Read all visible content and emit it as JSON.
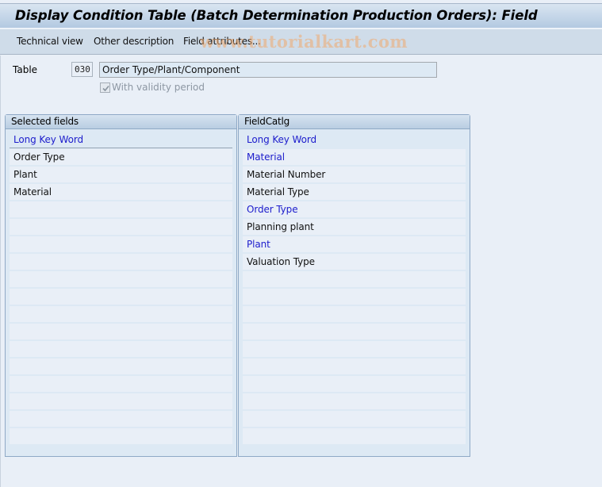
{
  "window": {
    "title": "Display Condition Table (Batch Determination Production Orders): Field"
  },
  "toolbar": {
    "buttons": [
      {
        "label": "Technical view"
      },
      {
        "label": "Other description"
      },
      {
        "label": "Field attributes..."
      }
    ]
  },
  "watermark": "www.tutorialkart.com",
  "form": {
    "table_label": "Table",
    "table_code": "030",
    "table_description": "Order Type/Plant/Component",
    "validity_checkbox": {
      "label": "With validity period",
      "checked": true,
      "enabled": false
    }
  },
  "selected_fields": {
    "title": "Selected fields",
    "column_header": "Long Key Word",
    "rows": [
      "Order Type",
      "Plant",
      "Material",
      "",
      "",
      "",
      "",
      "",
      "",
      "",
      "",
      "",
      "",
      "",
      "",
      "",
      ""
    ]
  },
  "field_catalog": {
    "title": "FieldCatlg",
    "column_header": "Long Key Word",
    "rows": [
      {
        "label": "Material",
        "highlighted": true
      },
      {
        "label": "Material Number",
        "highlighted": false
      },
      {
        "label": "Material Type",
        "highlighted": false
      },
      {
        "label": "Order Type",
        "highlighted": true
      },
      {
        "label": "Planning plant",
        "highlighted": false
      },
      {
        "label": "Plant",
        "highlighted": true
      },
      {
        "label": "Valuation Type",
        "highlighted": false
      },
      {
        "label": "",
        "highlighted": false
      },
      {
        "label": "",
        "highlighted": false
      },
      {
        "label": "",
        "highlighted": false
      },
      {
        "label": "",
        "highlighted": false
      },
      {
        "label": "",
        "highlighted": false
      },
      {
        "label": "",
        "highlighted": false
      },
      {
        "label": "",
        "highlighted": false
      },
      {
        "label": "",
        "highlighted": false
      },
      {
        "label": "",
        "highlighted": false
      },
      {
        "label": "",
        "highlighted": false
      }
    ]
  },
  "colors": {
    "highlight_text": "#1c1ccc",
    "background": "#e9eff7",
    "title_bar": "#b3c9e1",
    "watermark": "#f0aa6e"
  }
}
